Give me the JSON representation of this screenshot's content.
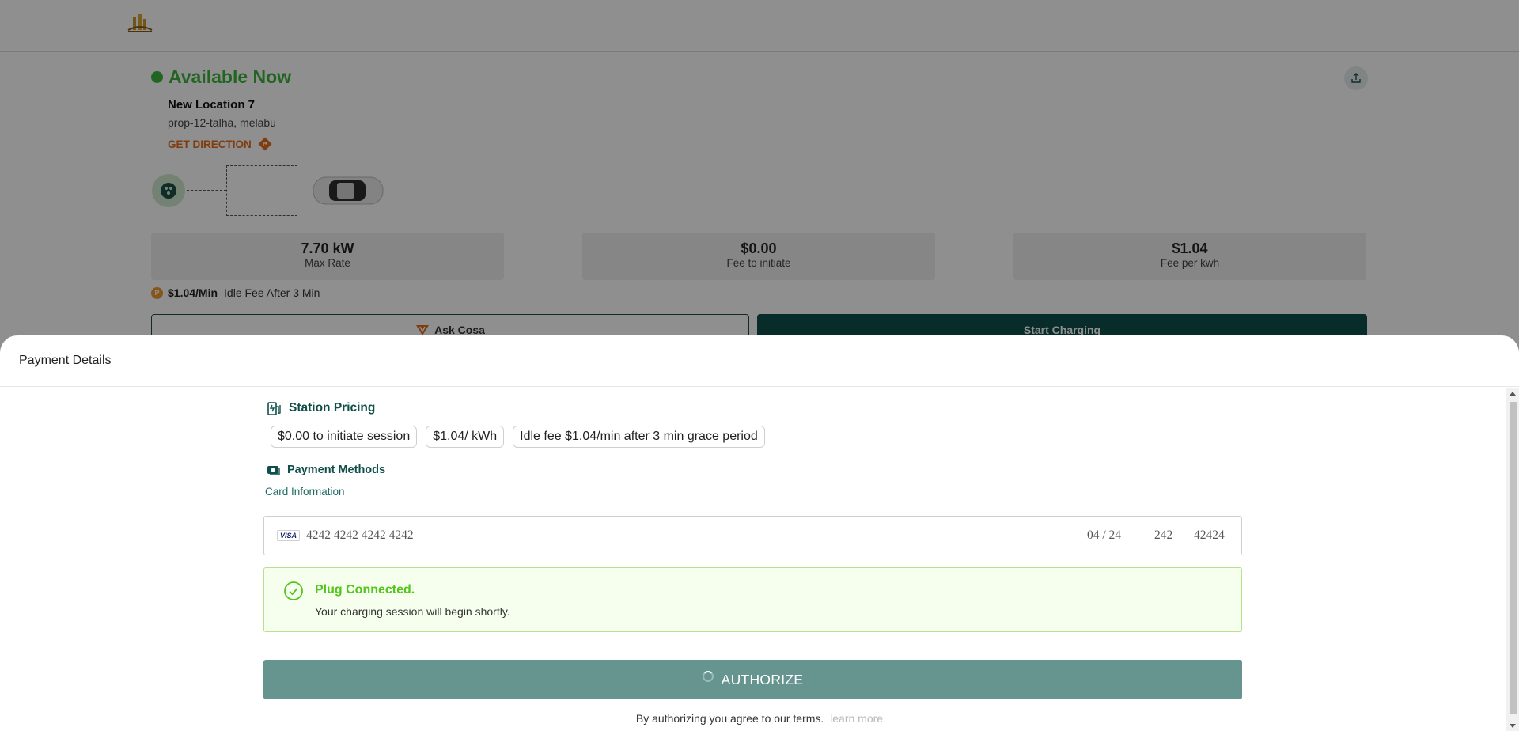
{
  "station": {
    "status": "Available Now",
    "name": "New Location 7",
    "address": "prop-12-talha, melabu",
    "get_direction": "GET DIRECTION",
    "stats": [
      {
        "value": "7.70 kW",
        "label": "Max Rate"
      },
      {
        "value": "$0.00",
        "label": "Fee to initiate"
      },
      {
        "value": "$1.04",
        "label": "Fee per kwh"
      }
    ],
    "idle_price": "$1.04/Min",
    "idle_text": "Idle Fee After 3 Min",
    "ask_label": "Ask Cosa",
    "start_label": "Start Charging"
  },
  "sheet": {
    "title": "Payment Details",
    "pricing_title": "Station Pricing",
    "chips": [
      "$0.00 to initiate session",
      "$1.04/ kWh",
      "Idle fee $1.04/min after 3 min grace period"
    ],
    "payment_title": "Payment Methods",
    "card_info_label": "Card Information",
    "card": {
      "brand": "VISA",
      "number": "4242 4242 4242 4242",
      "expiry": "04 / 24",
      "cvc": "242",
      "zip": "42424"
    },
    "alert": {
      "title": "Plug Connected.",
      "description": "Your charging session will begin shortly."
    },
    "authorize_label": "AUTHORIZE",
    "terms_text": "By authorizing you agree to our terms.",
    "terms_link": "learn more"
  },
  "colors": {
    "primary": "#0f4f4a",
    "available": "#3bb43b",
    "accent": "#e36b1b",
    "success": "#52c41a",
    "authorize_bg": "#66958f"
  },
  "icons": [
    "logo-icon",
    "share-icon",
    "direction-icon",
    "charger-port-icon",
    "car-icon",
    "idle-coin-icon",
    "ask-cosa-icon",
    "station-pricing-icon",
    "payment-methods-icon",
    "visa-icon",
    "check-circle-icon",
    "spinner-icon"
  ]
}
